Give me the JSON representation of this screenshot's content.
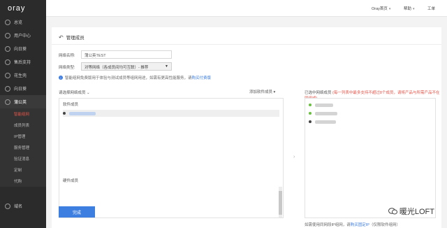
{
  "sidebar": {
    "logo": "oray",
    "items": [
      {
        "label": "总览"
      },
      {
        "label": "用户中心"
      },
      {
        "label": "向日葵"
      },
      {
        "label": "售后支持"
      },
      {
        "label": "花生壳"
      },
      {
        "label": "向日葵"
      },
      {
        "label": "蒲公英"
      }
    ],
    "sub_items": [
      {
        "label": "智能组网"
      },
      {
        "label": "成员列表"
      },
      {
        "label": "IP管理"
      },
      {
        "label": "服务管理"
      },
      {
        "label": "验证消息"
      },
      {
        "label": "定制"
      },
      {
        "label": "代购"
      }
    ],
    "bottom_item": {
      "label": "域名"
    }
  },
  "topbar": {
    "home_link": "Oray首页",
    "help_link": "帮助",
    "ticket_link": "工单"
  },
  "page": {
    "title": "管理成员",
    "network_name_label": "网络名称:",
    "network_name_value": "蒲公英TEST",
    "network_type_label": "网络类型:",
    "network_type_value": "对等网络（各成员间均可互联）- 推荐",
    "hint_text": "智能组网免费版用于体验与测试成员等组网用途，如需有更高性能服务，请",
    "hint_link": "购买付费版",
    "select_members_label": "请选择网络成员",
    "add_software_member": "添加软件成员",
    "selected_label": "已选中网络成员",
    "selected_note": "(每一列表中最多支持不超过8个成员，请将产品与所需产品不在同组成)",
    "software_members_label": "软件成员",
    "hardware_members_label": "硬件成员",
    "footer_text": "如需使用同网段IP组网，请",
    "footer_link": "购买固定IP",
    "footer_text2": "（仅限软件组网）",
    "done_button": "完成"
  },
  "watermark": {
    "text": "暖光LOFT"
  },
  "colors": {
    "sidebar_bg": "#2b2b2b",
    "accent_blue": "#3d7fe0",
    "accent_red": "#e5554a",
    "online_green": "#6abf3f"
  }
}
